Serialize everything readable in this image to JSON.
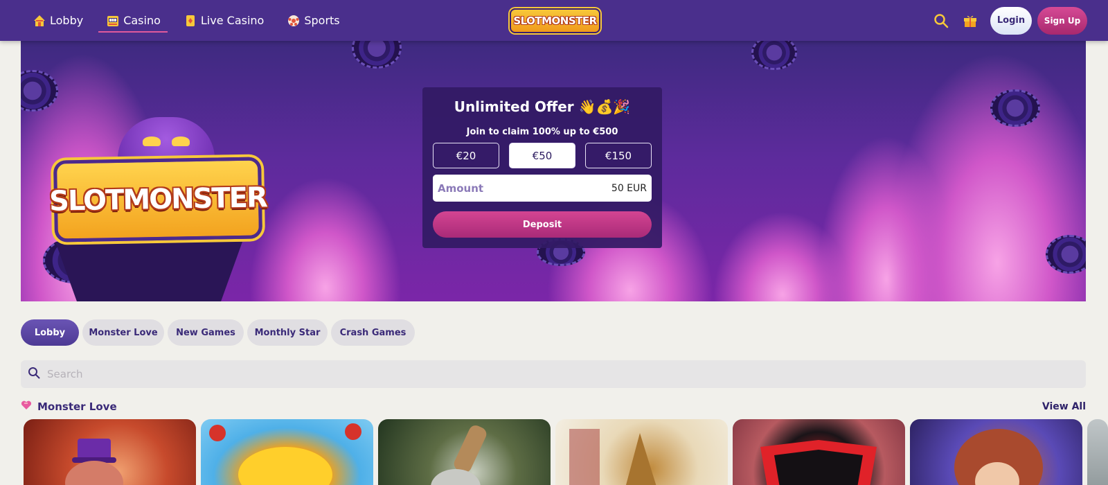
{
  "header": {
    "nav": [
      {
        "label": "Lobby",
        "icon": "house-icon"
      },
      {
        "label": "Casino",
        "icon": "slot-machine-icon"
      },
      {
        "label": "Live Casino",
        "icon": "cards-icon"
      },
      {
        "label": "Sports",
        "icon": "soccer-ball-icon"
      }
    ],
    "active_nav": "Casino",
    "logo_text": "SLOTMONSTER",
    "login_label": "Login",
    "signup_label": "Sign Up"
  },
  "banner": {
    "logo_text": "SLOTMONSTER",
    "offer": {
      "title": "Unlimited Offer 👋💰🎉",
      "subtitle": "Join to claim 100% up to €500",
      "amount_options": [
        "€20",
        "€50",
        "€150"
      ],
      "selected_amount": "€50",
      "amount_label": "Amount",
      "amount_value": "50 EUR",
      "deposit_label": "Deposit"
    }
  },
  "filters": {
    "tabs": [
      "Lobby",
      "Monster Love",
      "New Games",
      "Monthly Star",
      "Crash Games"
    ],
    "active": "Lobby"
  },
  "search": {
    "placeholder": "Search"
  },
  "section": {
    "title": "Monster Love",
    "view_all_label": "View All"
  },
  "colors": {
    "header_bg": "#4a2f8c",
    "accent_pink": "#c23882",
    "page_bg": "#f1f0eb",
    "text_primary": "#3a2a78"
  }
}
